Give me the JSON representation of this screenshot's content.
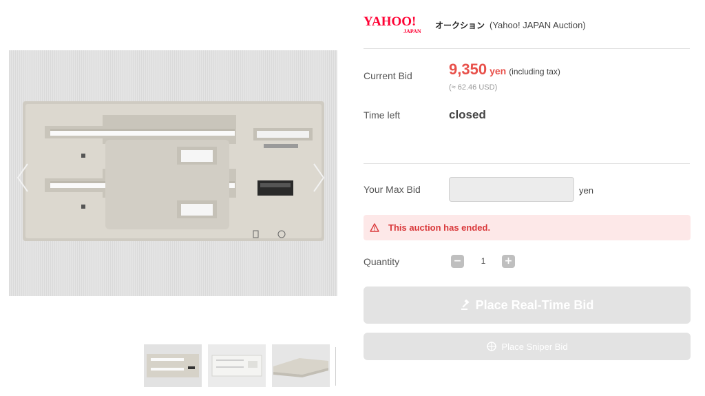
{
  "brand": {
    "logo_text": "YAHOO!",
    "logo_sub": "JAPAN",
    "name_jp": "オークション",
    "name_en": "(Yahoo! JAPAN Auction)",
    "logo_color": "#ff0033"
  },
  "gallery": {
    "thumbnail_count_visible": 3,
    "main_image_alt": "floppy drive face plate"
  },
  "bid_panel": {
    "current_bid_label": "Current Bid",
    "price_amount": "9,350",
    "price_unit": "yen",
    "price_tax_note": "(including tax)",
    "price_usd": "(≈ 62.46 USD)",
    "time_left_label": "Time left",
    "time_left_value": "closed",
    "max_bid_label": "Your Max Bid",
    "max_bid_value": "",
    "max_bid_unit": "yen",
    "alert_text": "This auction has ended.",
    "quantity_label": "Quantity",
    "quantity_value": "1",
    "minus_symbol": "−",
    "plus_symbol": "+",
    "realtime_bid_label": "Place Real-Time Bid",
    "sniper_bid_label": "Place Sniper Bid"
  },
  "icons": {
    "prev": "chevron-left-icon",
    "next": "chevron-right-icon",
    "alert": "warning-triangle-icon",
    "realtime": "gavel-icon",
    "sniper": "crosshair-icon"
  },
  "colors": {
    "price": "#e8504a",
    "alert_bg": "#fde8e8",
    "alert_text": "#d9383a",
    "button_disabled": "#e3e3e3",
    "stepper": "#bfbfbf"
  }
}
